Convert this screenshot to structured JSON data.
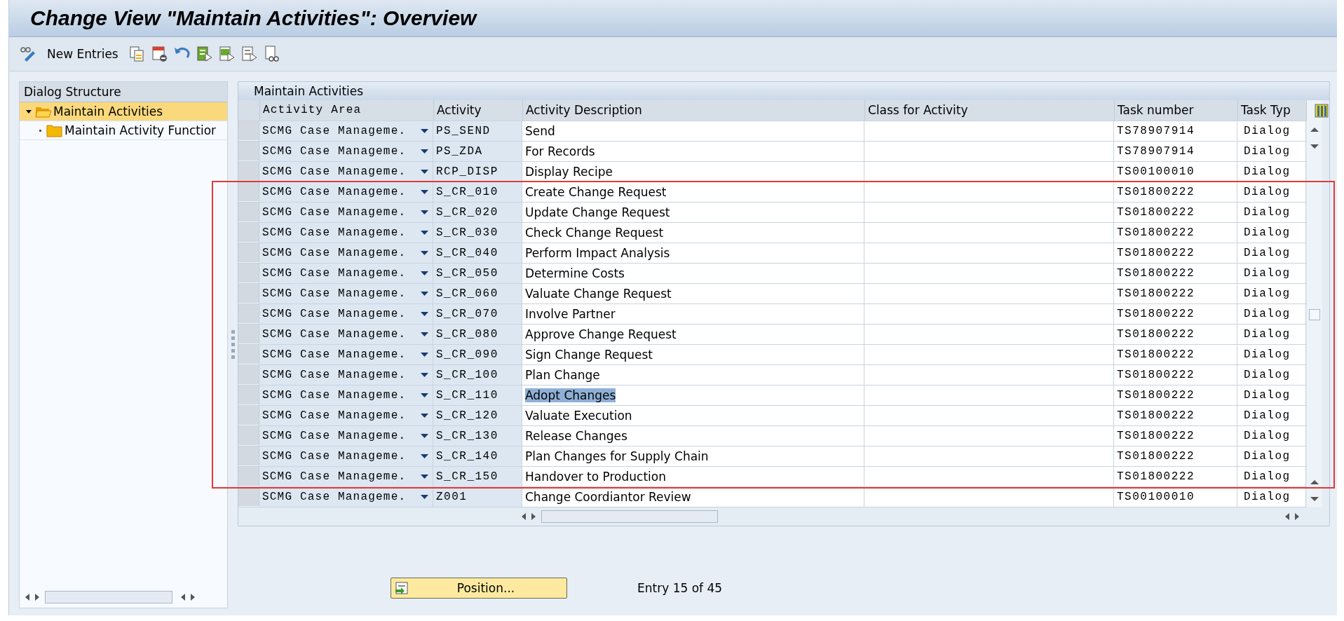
{
  "window": {
    "title": "Change View \"Maintain Activities\": Overview"
  },
  "toolbar": {
    "items": [
      {
        "kind": "icon"
      },
      {
        "kind": "text",
        "label": "New Entries"
      },
      {
        "kind": "icon"
      },
      {
        "kind": "icon"
      },
      {
        "kind": "icon"
      },
      {
        "kind": "icon"
      },
      {
        "kind": "icon"
      },
      {
        "kind": "icon"
      },
      {
        "kind": "icon"
      }
    ]
  },
  "dialog_structure": {
    "title": "Dialog Structure",
    "items": [
      {
        "label": "Maintain Activities",
        "selected": true,
        "expanded": true,
        "children": [
          {
            "label": "Maintain Activity Functior",
            "selected": false,
            "expanded": false
          }
        ]
      }
    ]
  },
  "table": {
    "title": "Maintain Activities",
    "columns": [
      "Activity Area",
      "Activity",
      "Activity Description",
      "Class for Activity",
      "Task number",
      "Task Typ"
    ],
    "row_groups": [
      {
        "framed": false,
        "rows": [
          {
            "area": "SCMG Case Manageme.",
            "activity": "PS_SEND",
            "description": "Send",
            "task_number": "TS78907914",
            "task_type": "Dialog",
            "selected": false
          },
          {
            "area": "SCMG Case Manageme.",
            "activity": "PS_ZDA",
            "description": "For Records",
            "task_number": "TS78907914",
            "task_type": "Dialog",
            "selected": false
          },
          {
            "area": "SCMG Case Manageme.",
            "activity": "RCP_DISP",
            "description": "Display Recipe",
            "task_number": "TS00100010",
            "task_type": "Dialog",
            "selected": false
          }
        ]
      },
      {
        "framed": true,
        "rows": [
          {
            "area": "SCMG Case Manageme.",
            "activity": "S_CR_010",
            "description": "Create Change Request",
            "task_number": "TS01800222",
            "task_type": "Dialog",
            "selected": false
          },
          {
            "area": "SCMG Case Manageme.",
            "activity": "S_CR_020",
            "description": "Update Change Request",
            "task_number": "TS01800222",
            "task_type": "Dialog",
            "selected": false
          },
          {
            "area": "SCMG Case Manageme.",
            "activity": "S_CR_030",
            "description": "Check Change Request",
            "task_number": "TS01800222",
            "task_type": "Dialog",
            "selected": false
          },
          {
            "area": "SCMG Case Manageme.",
            "activity": "S_CR_040",
            "description": "Perform Impact Analysis",
            "task_number": "TS01800222",
            "task_type": "Dialog",
            "selected": false
          },
          {
            "area": "SCMG Case Manageme.",
            "activity": "S_CR_050",
            "description": "Determine Costs",
            "task_number": "TS01800222",
            "task_type": "Dialog",
            "selected": false
          },
          {
            "area": "SCMG Case Manageme.",
            "activity": "S_CR_060",
            "description": "Valuate Change Request",
            "task_number": "TS01800222",
            "task_type": "Dialog",
            "selected": false
          },
          {
            "area": "SCMG Case Manageme.",
            "activity": "S_CR_070",
            "description": "Involve Partner",
            "task_number": "TS01800222",
            "task_type": "Dialog",
            "selected": false
          },
          {
            "area": "SCMG Case Manageme.",
            "activity": "S_CR_080",
            "description": "Approve Change Request",
            "task_number": "TS01800222",
            "task_type": "Dialog",
            "selected": false
          },
          {
            "area": "SCMG Case Manageme.",
            "activity": "S_CR_090",
            "description": "Sign Change Request",
            "task_number": "TS01800222",
            "task_type": "Dialog",
            "selected": false
          },
          {
            "area": "SCMG Case Manageme.",
            "activity": "S_CR_100",
            "description": "Plan Change",
            "task_number": "TS01800222",
            "task_type": "Dialog",
            "selected": false
          },
          {
            "area": "SCMG Case Manageme.",
            "activity": "S_CR_110",
            "description": "Adopt Changes",
            "task_number": "TS01800222",
            "task_type": "Dialog",
            "selected": true
          },
          {
            "area": "SCMG Case Manageme.",
            "activity": "S_CR_120",
            "description": "Valuate Execution",
            "task_number": "TS01800222",
            "task_type": "Dialog",
            "selected": false
          },
          {
            "area": "SCMG Case Manageme.",
            "activity": "S_CR_130",
            "description": "Release Changes",
            "task_number": "TS01800222",
            "task_type": "Dialog",
            "selected": false
          },
          {
            "area": "SCMG Case Manageme.",
            "activity": "S_CR_140",
            "description": "Plan Changes for Supply Chain",
            "task_number": "TS01800222",
            "task_type": "Dialog",
            "selected": false
          },
          {
            "area": "SCMG Case Manageme.",
            "activity": "S_CR_150",
            "description": "Handover to Production",
            "task_number": "TS01800222",
            "task_type": "Dialog",
            "selected": false
          }
        ]
      },
      {
        "framed": false,
        "rows": [
          {
            "area": "SCMG Case Manageme.",
            "activity": "Z001",
            "description": "Change Coordiantor Review",
            "task_number": "TS00100010",
            "task_type": "Dialog",
            "selected": false
          }
        ]
      }
    ]
  },
  "footer": {
    "button": "Position...",
    "entry": "Entry 15 of 45"
  }
}
